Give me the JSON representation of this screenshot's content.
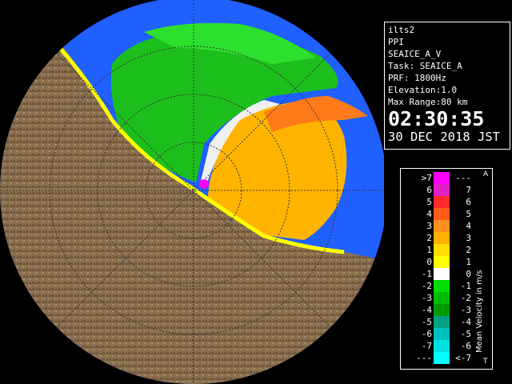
{
  "info": {
    "site": "ilts2",
    "scan": "PPI",
    "product": "SEAICE_A_V",
    "task": "Task: SEAICE_A",
    "prf": "PRF: 1800Hz",
    "elevation": "Elevation:1.0",
    "max_range": "Max Range:80 km",
    "time": "02:30:35",
    "date": "30 DEC 2018 JST"
  },
  "legend": {
    "title": "Mean Velocity in m/s",
    "top_mark": "A",
    "bottom_mark": "T",
    "rows": [
      {
        "left": ">7",
        "right": "---",
        "color": "#ff00ff"
      },
      {
        "left": "6",
        "right": "7",
        "color": "#e020c8"
      },
      {
        "left": "5",
        "right": "6",
        "color": "#ff2a2a"
      },
      {
        "left": "4",
        "right": "5",
        "color": "#ff5a1a"
      },
      {
        "left": "3",
        "right": "4",
        "color": "#ff9020"
      },
      {
        "left": "2",
        "right": "3",
        "color": "#ffb000"
      },
      {
        "left": "1",
        "right": "2",
        "color": "#ffdd00"
      },
      {
        "left": "0",
        "right": "1",
        "color": "#ffff00"
      },
      {
        "left": "-1",
        "right": "0",
        "color": "#ffffff"
      },
      {
        "left": "-2",
        "right": "-1",
        "color": "#00dd00"
      },
      {
        "left": "-3",
        "right": "-2",
        "color": "#00bb00"
      },
      {
        "left": "-4",
        "right": "-3",
        "color": "#009a00"
      },
      {
        "left": "-5",
        "right": "-4",
        "color": "#00a080"
      },
      {
        "left": "-6",
        "right": "-5",
        "color": "#00c0c0"
      },
      {
        "left": "-7",
        "right": "-6",
        "color": "#00e0e0"
      },
      {
        "left": "---",
        "right": "<-7",
        "color": "#00ffff"
      }
    ]
  },
  "colors": {
    "background": "#000000",
    "radar_range": "#2060ff",
    "land": "#8a6e4e",
    "coast": "#ffff00",
    "outflow": "#ffb000",
    "inflow": "#22cc22"
  }
}
